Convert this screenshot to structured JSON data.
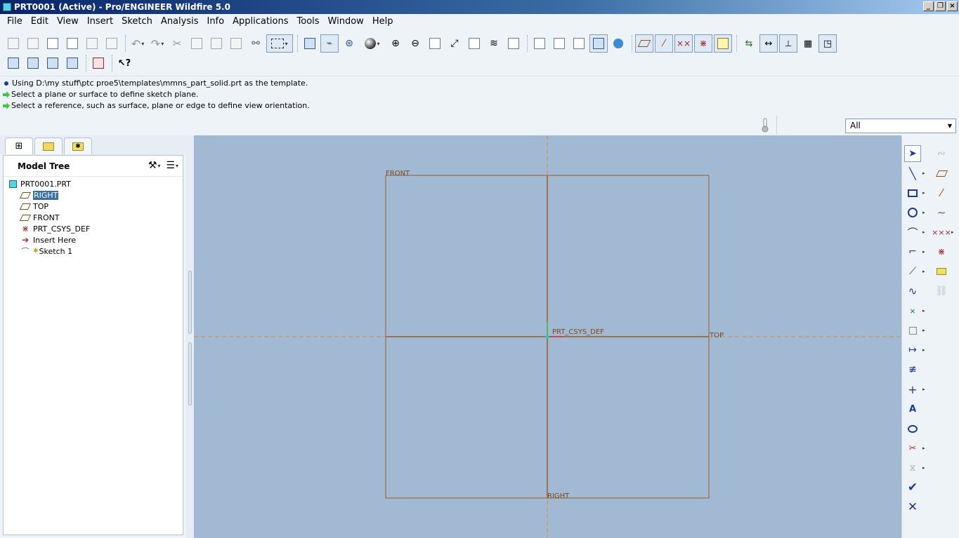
{
  "window": {
    "title": "PRT0001 (Active) - Pro/ENGINEER Wildfire 5.0",
    "controls": [
      "minimize",
      "restore",
      "close"
    ]
  },
  "menu": [
    "File",
    "Edit",
    "View",
    "Insert",
    "Sketch",
    "Analysis",
    "Info",
    "Applications",
    "Tools",
    "Window",
    "Help"
  ],
  "messages": [
    {
      "icon": "info-bullet",
      "text": "Using D:\\my stuff\\ptc proe5\\templates\\mmns_part_solid.prt as the template."
    },
    {
      "icon": "prompt-arrow",
      "text": "Select a plane or surface to define sketch plane."
    },
    {
      "icon": "prompt-arrow",
      "text": "Select a reference, such as surface, plane or edge to define view orientation."
    }
  ],
  "filter": {
    "value": "All"
  },
  "navigator": {
    "tabs": [
      "model-tree-tab",
      "layers-tab",
      "favorites-tab"
    ],
    "title": "Model Tree",
    "tree": {
      "root": "PRT0001.PRT",
      "items": [
        {
          "label": "RIGHT",
          "icon": "datum-plane-icon",
          "selected": true
        },
        {
          "label": "TOP",
          "icon": "datum-plane-icon",
          "selected": false
        },
        {
          "label": "FRONT",
          "icon": "datum-plane-icon",
          "selected": false
        },
        {
          "label": "PRT_CSYS_DEF",
          "icon": "coordinate-system-icon",
          "selected": false
        },
        {
          "label": "Insert Here",
          "icon": "insert-arrow-icon",
          "selected": false
        },
        {
          "label": "Sketch 1",
          "icon": "sketch-icon",
          "selected": false
        }
      ]
    }
  },
  "graphics": {
    "labels": {
      "front": "FRONT",
      "top": "TOP",
      "right": "RIGHT",
      "csys": "PRT_CSYS_DEF"
    },
    "colors": {
      "background": "#a2b9d3",
      "datum": "#9a5a2a",
      "reference": "#e08a2a"
    }
  },
  "toolbar": {
    "row1": [
      "new",
      "open",
      "save",
      "print",
      "email",
      "email-link",
      "undo",
      "redo",
      "cut",
      "copy",
      "paste",
      "paste-special",
      "regenerate",
      "selection-box",
      "sketch-view",
      "sketch-references",
      "spin-center",
      "shading",
      "zoom-in",
      "zoom-out",
      "refit",
      "reorient",
      "saved-views",
      "layers",
      "view-manager",
      "wireframe",
      "hidden-line",
      "no-hidden",
      "shaded",
      "enhanced-realism",
      "datum-planes",
      "datum-axes",
      "datum-points",
      "csys",
      "annotations",
      "relations",
      "dimensions",
      "constraints",
      "grid",
      "vertices"
    ],
    "row2": [
      "select-all",
      "select-chain",
      "select-intent",
      "select-filter",
      "measure",
      "whats-this"
    ]
  },
  "sketch_tools": {
    "col1": [
      "select",
      "line",
      "rectangle",
      "circle",
      "arc",
      "fillet",
      "chamfer",
      "spline",
      "point",
      "offset",
      "dimension",
      "modify",
      "constraint",
      "text",
      "palette",
      "trim",
      "mirror",
      "done",
      "quit"
    ],
    "col2": [
      "sketch-tool-disabled",
      "datum-plane",
      "datum-axis",
      "curve",
      "datum-point",
      "csys",
      "analysis",
      "link-disabled"
    ]
  }
}
